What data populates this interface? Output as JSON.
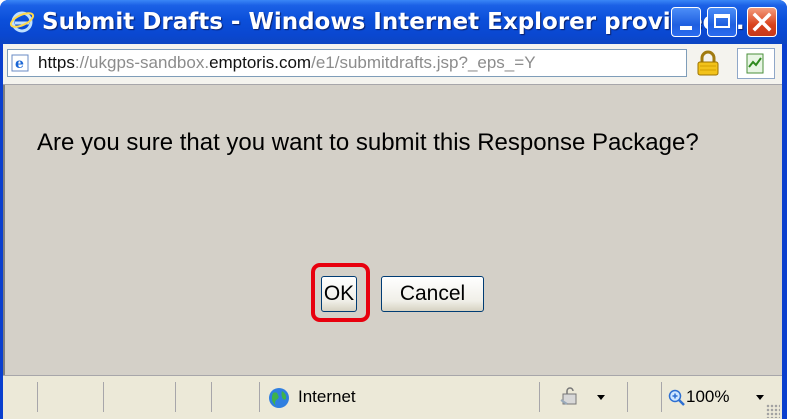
{
  "window": {
    "title": "Submit Drafts - Windows Internet Explorer provided ...",
    "icon": "ie-logo-icon",
    "controls": [
      "minimize-icon",
      "maximize-icon",
      "close-icon"
    ]
  },
  "address": {
    "scheme": "https",
    "sep": "://",
    "host_pre": "ukgps-sandbox.",
    "host_main": "emptoris.com",
    "path": "/e1/submitdrafts.jsp?_eps_=Y",
    "page_icon": "ie-page-icon",
    "lock_icon": "padlock-icon",
    "security_icon": "security-report-icon"
  },
  "dialog": {
    "message": "Are you sure that you want to submit this Response Package?",
    "ok_label": "OK",
    "cancel_label": "Cancel",
    "highlight_color": "#e8000e"
  },
  "status": {
    "zone": "Internet",
    "zone_icon": "globe-icon",
    "zoom": "100%",
    "zoom_icon": "zoom-icon"
  }
}
